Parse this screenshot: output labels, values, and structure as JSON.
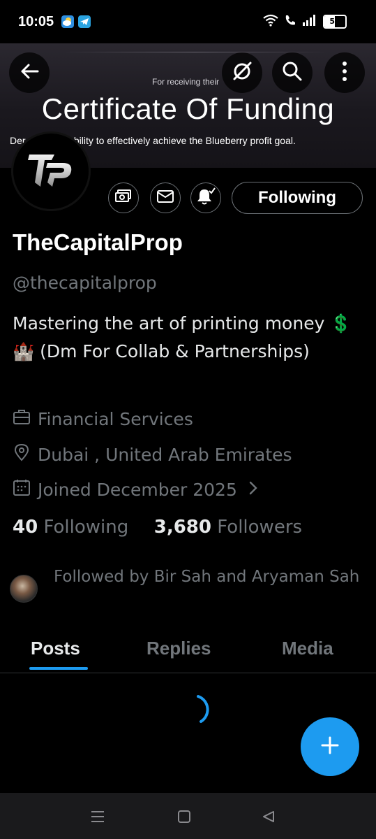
{
  "status_bar": {
    "time": "10:05",
    "battery": "50",
    "icons": [
      "weather-app-icon",
      "telegram-app-icon",
      "wifi-icon",
      "call-icon",
      "signal-icon",
      "battery-icon"
    ]
  },
  "header": {
    "icons": [
      "back-arrow-icon",
      "grok-icon",
      "search-icon",
      "more-vertical-icon"
    ]
  },
  "banner": {
    "small_text": "For receiving their",
    "title": "Certificate Of Funding",
    "subtitle": "Der           g the capability to effectively achieve the Blueberry profit goal."
  },
  "profile": {
    "avatar_logo": "TP",
    "following_label": "Following",
    "name": "TheCapitalProp",
    "handle": "@thecapitalprop",
    "bio": "Mastering the art of printing money 💲🏰  (Dm For Collab & Partnerships)",
    "category": "Financial Services",
    "location": "Dubai , United Arab Emirates",
    "joined": "Joined December 2025",
    "following_count": "40",
    "following_word": "Following",
    "followers_count": "3,680",
    "followers_word": "Followers",
    "followed_by": "Followed by Bir Sah and Aryaman Sah"
  },
  "tabs": [
    {
      "label": "Posts",
      "active": true
    },
    {
      "label": "Replies",
      "active": false
    },
    {
      "label": "Media",
      "active": false
    }
  ],
  "colors": {
    "accent": "#1d9bf0",
    "secondary_text": "#71767b",
    "primary_text": "#e7e9ea",
    "background": "#000000"
  }
}
